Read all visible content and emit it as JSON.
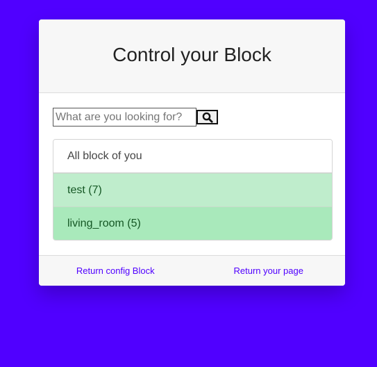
{
  "card": {
    "title": "Control your Block"
  },
  "search": {
    "placeholder": "What are you looking for?",
    "value": ""
  },
  "list": {
    "header": "All block of you",
    "items": [
      {
        "label": "test (7)"
      },
      {
        "label": "living_room (5)"
      }
    ]
  },
  "footer": {
    "return_config_label": "Return config Block",
    "return_page_label": "Return your page"
  },
  "colors": {
    "background": "#5000ff",
    "link": "#5000ff",
    "item_green_light": "#bfedcc",
    "item_green": "#a9e9bb",
    "item_text": "#155724"
  },
  "icons": {
    "search_button": "search-icon"
  }
}
